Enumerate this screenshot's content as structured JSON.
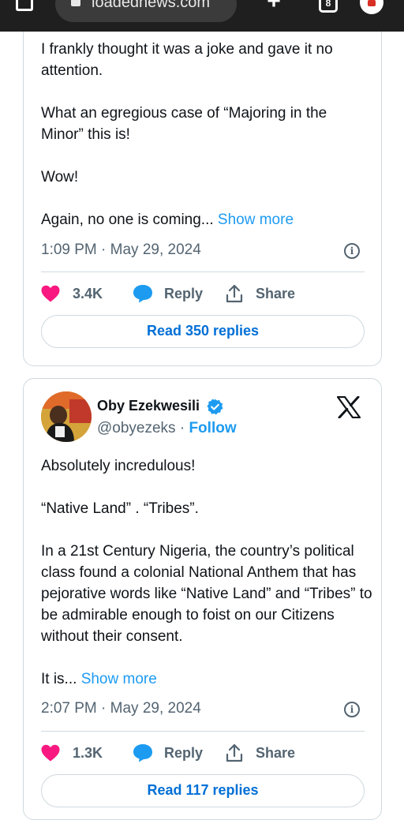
{
  "browser": {
    "url": "loadednews.com",
    "tab_count": "8"
  },
  "tweet1": {
    "paragraphs": [
      "I frankly thought it was a joke and gave it no attention.",
      "What an egregious case of “Majoring in the Minor” this is!",
      "Wow!"
    ],
    "last_paragraph": "Again, no one is coming...",
    "show_more": "Show more",
    "timestamp": "1:09 PM · May 29, 2024",
    "likes": "3.4K",
    "reply_label": "Reply",
    "share_label": "Share",
    "read_replies": "Read 350 replies"
  },
  "tweet2": {
    "author_name": "Oby Ezekwesili",
    "handle": "@obyezeks",
    "separator": "·",
    "follow_label": "Follow",
    "paragraphs": [
      "Absolutely incredulous!",
      "“Native Land” . “Tribes”.",
      "In a 21st Century Nigeria, the country’s political class found a colonial National Anthem that has pejorative words like “Native Land” and “Tribes” to be admirable enough to foist on our Citizens without their consent."
    ],
    "last_paragraph": "It is...",
    "show_more": "Show more",
    "timestamp": "2:07 PM · May 29, 2024",
    "likes": "1.3K",
    "reply_label": "Reply",
    "share_label": "Share",
    "read_replies": "Read 117 replies"
  },
  "colors": {
    "heart": "#f91880",
    "reply_bubble": "#1d9bf0",
    "link": "#1d9bf0",
    "verified": "#1d9bf0"
  },
  "icons": [
    "home-icon",
    "lock-icon",
    "plus-icon",
    "tabs-icon",
    "profile-icon",
    "info-icon",
    "heart-icon",
    "reply-icon",
    "share-icon",
    "verified-icon",
    "x-logo-icon"
  ]
}
